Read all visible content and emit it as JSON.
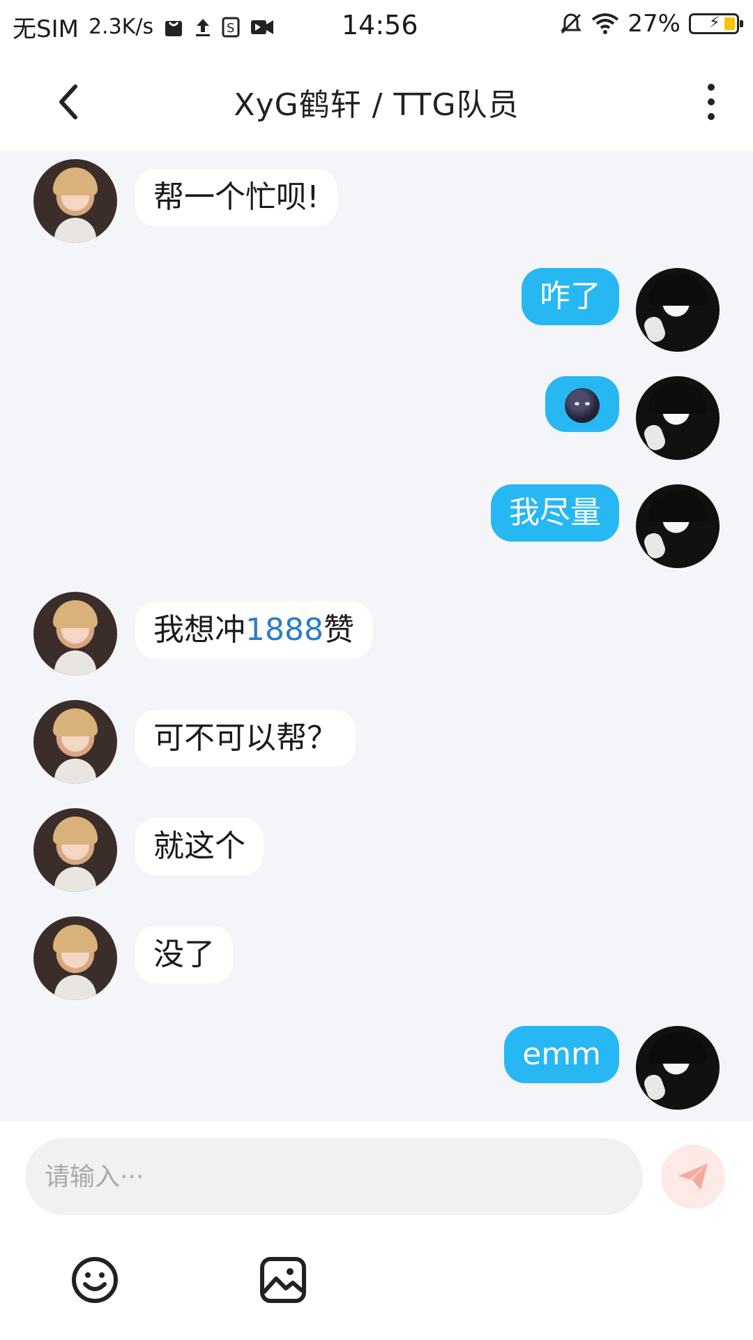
{
  "status_bar": {
    "carrier": "无SIM",
    "speed": "2.3K/s",
    "time": "14:56",
    "battery": "27%",
    "icons": [
      "shopping-bag-icon",
      "upload-icon",
      "sim-s-icon",
      "video-icon",
      "mute-bell-icon",
      "wifi-icon",
      "battery-charging-icon"
    ]
  },
  "header": {
    "title": "XyG鹤轩 / TTG队员",
    "back_icon": "chevron-left-icon",
    "more_icon": "more-vertical-icon"
  },
  "messages": [
    {
      "side": "in",
      "text": "帮一个忙呗!"
    },
    {
      "side": "out",
      "text": "咋了"
    },
    {
      "side": "out",
      "text": "",
      "emoji": "new-moon-face-emoji"
    },
    {
      "side": "out",
      "text": "我尽量"
    },
    {
      "side": "in",
      "text_before": "我想冲",
      "link": "1888",
      "text_after": "赞"
    },
    {
      "side": "in",
      "text": "可不可以帮？"
    },
    {
      "side": "in",
      "text": "就这个"
    },
    {
      "side": "in",
      "text": "没了"
    },
    {
      "side": "out",
      "text": "emm"
    }
  ],
  "composer": {
    "placeholder": "请输入···",
    "send_icon": "paper-plane-icon",
    "tools": [
      "smiley-icon",
      "image-icon"
    ]
  },
  "colors": {
    "outgoing_bubble": "#27b7f2",
    "incoming_bubble": "#ffffff",
    "chat_background": "#f4f5f8",
    "link": "#2b7cc9",
    "send_button_bg": "#fde9e6",
    "send_icon": "#f7a99d"
  }
}
